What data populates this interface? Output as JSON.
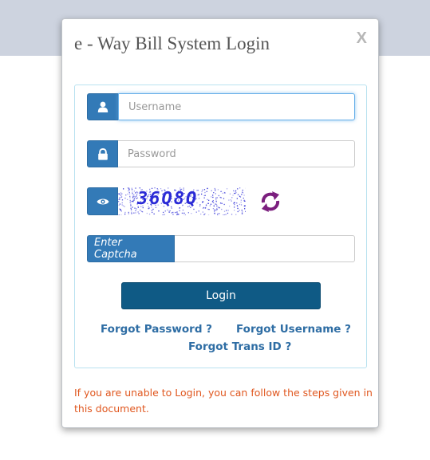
{
  "modal": {
    "title": "e - Way Bill System Login",
    "close_label": "X"
  },
  "form": {
    "username": {
      "placeholder": "Username",
      "value": "",
      "icon": "user-icon"
    },
    "password": {
      "placeholder": "Password",
      "value": "",
      "icon": "lock-icon"
    },
    "captcha": {
      "image_text": "36Q8Q",
      "eye_icon": "eye-icon",
      "refresh_icon": "refresh-icon",
      "input_label": "Enter Captcha",
      "input_value": ""
    },
    "login_label": "Login"
  },
  "links": {
    "forgot_password": "Forgot Password ?",
    "forgot_username": "Forgot Username ?",
    "forgot_trans_id": "Forgot Trans ID ?"
  },
  "notice": "If you are unable to Login, you can follow the steps given in this document.",
  "colors": {
    "backdrop": "#cdd3df",
    "addon": "#337ab7",
    "login_button": "#0f5a85",
    "link": "#2e6da4",
    "notice": "#e0571f",
    "panel_border": "#b9e2f0",
    "refresh_icon": "#7b1f7e",
    "captcha_text": "#2b2bd6"
  }
}
